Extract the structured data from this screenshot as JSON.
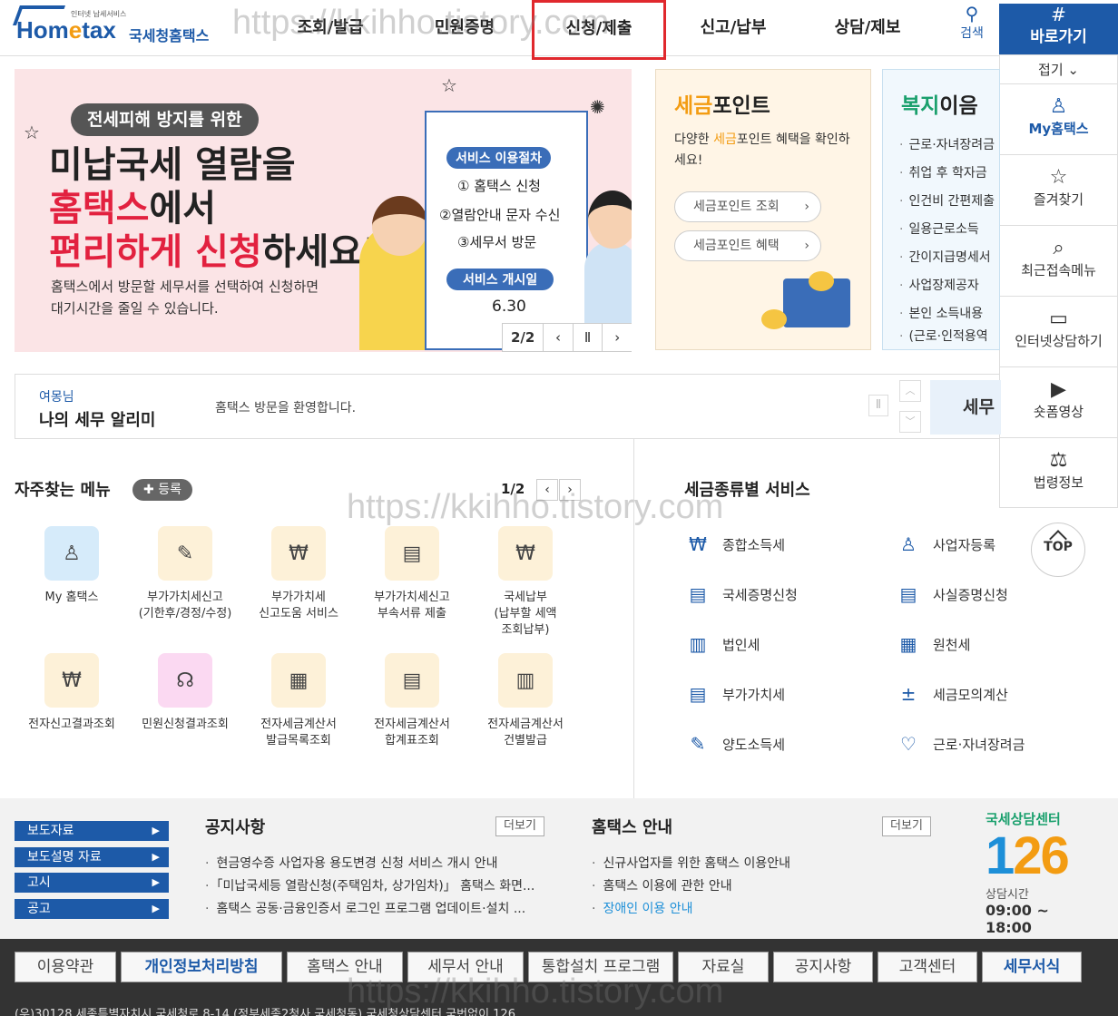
{
  "header": {
    "logo_small": "인터넷 납세서비스",
    "logo_home_pre": "Hom",
    "logo_home_e": "e",
    "logo_home_post": "tax",
    "logo_korean": "국세청홈택스",
    "nav": [
      "조회/발급",
      "민원증명",
      "신청/제출",
      "신고/납부",
      "상담/제보"
    ],
    "active_nav": "신청/제출",
    "search_label": "검색",
    "quick_label": "바로가기",
    "accent_color": "#1d5aa8",
    "highlight_color": "#e0282d"
  },
  "quick_menu": {
    "fold_label": "접기",
    "items": [
      {
        "label": "My홈택스",
        "icon": "person-icon"
      },
      {
        "label": "즐겨찾기",
        "icon": "star-icon"
      },
      {
        "label": "최근접속메뉴",
        "icon": "recent-icon"
      },
      {
        "label": "인터넷상담하기",
        "icon": "laptop-icon"
      },
      {
        "label": "숏폼영상",
        "icon": "play-icon"
      },
      {
        "label": "법령정보",
        "icon": "gavel-icon"
      }
    ],
    "top_label": "TOP"
  },
  "banner": {
    "pill": "전세피해 방지를 위한",
    "line1": "미납국세 열람을",
    "line2_red": "홈택스",
    "line2_rest": "에서",
    "line3_red": "편리하게 신청",
    "line3_rest": "하세요!",
    "sub1": "홈택스에서 방문할 세무서를 선택하여 신청하면",
    "sub2": "대기시간을 줄일 수 있습니다.",
    "process_title": "서비스 이용절차",
    "steps": [
      "① 홈택스 신청",
      "②열람안내 문자 수신",
      "③세무서 방문"
    ],
    "start_title": "서비스 개시일",
    "start_date": "6.30",
    "page": "2/2"
  },
  "tax_point": {
    "title_accent": "세금",
    "title_rest": "포인트",
    "desc_pre": "다양한 ",
    "desc_accent": "세금",
    "desc_post": "포인트 혜택을 확인하세요!",
    "btn1": "세금포인트 조회",
    "btn2": "세금포인트 혜택"
  },
  "welfare": {
    "title_accent": "복지",
    "title_rest": "이음",
    "items": [
      "근로·자녀장려금",
      "취업 후 학자금",
      "인건비 간편제출",
      "일용근로소득",
      "간이지급명세서",
      "사업장제공자",
      "본인 소득내용",
      "(근로·인적용역"
    ]
  },
  "alarm": {
    "name": "여몽님",
    "title": "나의 세무 알리미",
    "message": "홈택스 방문을 환영합니다.",
    "tax_btn": "세무"
  },
  "favorites": {
    "title": "자주찾는 메뉴",
    "register": "등록",
    "page": "1/2",
    "items": [
      {
        "label": "My 홈택스",
        "icon": "person-icon"
      },
      {
        "label": "부가가치세신고\n(기한후/경정/수정)",
        "icon": "vat-icon"
      },
      {
        "label": "부가가치세\n신고도움 서비스",
        "icon": "won-search-icon"
      },
      {
        "label": "부가가치세신고\n부속서류 제출",
        "icon": "doc-plus-icon"
      },
      {
        "label": "국세납부\n(납부할 세액\n조회납부)",
        "icon": "money-bag-icon"
      },
      {
        "label": "전자신고결과조회",
        "icon": "won-search-icon"
      },
      {
        "label": "민원신청결과조회",
        "icon": "headset-icon"
      },
      {
        "label": "전자세금계산서\n발급목록조회",
        "icon": "doc-search-icon"
      },
      {
        "label": "전자세금계산서\n합계표조회",
        "icon": "doc-plus-icon"
      },
      {
        "label": "전자세금계산서\n건별발급",
        "icon": "calculator-doc-icon"
      }
    ]
  },
  "tax_services": {
    "title": "세금종류별 서비스",
    "items": [
      {
        "label": "종합소득세",
        "icon": "money-bag-icon"
      },
      {
        "label": "사업자등록",
        "icon": "person-icon"
      },
      {
        "label": "국세증명신청",
        "icon": "document-icon"
      },
      {
        "label": "사실증명신청",
        "icon": "document-icon"
      },
      {
        "label": "법인세",
        "icon": "building-icon"
      },
      {
        "label": "원천세",
        "icon": "salary-icon"
      },
      {
        "label": "부가가치세",
        "icon": "vat-doc-icon"
      },
      {
        "label": "세금모의계산",
        "icon": "calculator-icon"
      },
      {
        "label": "양도소득세",
        "icon": "transfer-doc-icon"
      },
      {
        "label": "근로·자녀장려금",
        "icon": "heart-icon"
      }
    ]
  },
  "press": [
    "보도자료",
    "보도설명 자료",
    "고시",
    "공고"
  ],
  "notice": {
    "title": "공지사항",
    "more": "더보기",
    "items": [
      "현금영수증 사업자용 용도변경 신청 서비스 개시 안내",
      "「미납국세등 열람신청(주택임차, 상가임차)」 홈택스 화면...",
      "홈택스 공동·금융인증서 로그인 프로그램 업데이트·설치 ..."
    ]
  },
  "guide": {
    "title": "홈택스 안내",
    "more": "더보기",
    "items": [
      "신규사업자를 위한 홈택스 이용안내",
      "홈택스 이용에 관한 안내"
    ],
    "link": "장애인 이용 안내"
  },
  "center": {
    "title": "국세상담센터",
    "num1": "1",
    "num2": "26",
    "hours_label": "상담시간",
    "hours": "09:00 ~ 18:00"
  },
  "footer": {
    "links": [
      {
        "label": "이용약관",
        "bold": false
      },
      {
        "label": "개인정보처리방침",
        "bold": true
      },
      {
        "label": "홈택스 안내",
        "bold": false
      },
      {
        "label": "세무서 안내",
        "bold": false
      },
      {
        "label": "통합설치 프로그램",
        "bold": false
      },
      {
        "label": "자료실",
        "bold": false
      },
      {
        "label": "공지사항",
        "bold": false
      },
      {
        "label": "고객센터",
        "bold": false
      },
      {
        "label": "세무서식",
        "bold": true
      }
    ],
    "address": "(우)30128 세종특별자치시 국세청로 8-14 (정부세종2청사 국세청동) 국세청상담센터 국번없이 126"
  },
  "watermark": "https://kkihho.tistory.com"
}
